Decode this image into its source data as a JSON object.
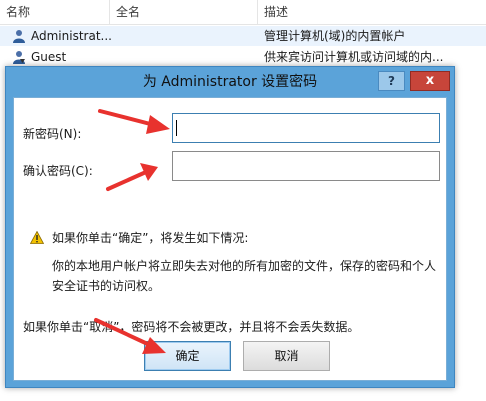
{
  "listview": {
    "columns": [
      "名称",
      "全名",
      "描述"
    ],
    "rows": [
      {
        "name": "Administrat...",
        "fullname": "",
        "description": "管理计算机(域)的内置帐户",
        "icon": "user-icon"
      },
      {
        "name": "Guest",
        "fullname": "",
        "description": "供来宾访问计算机或访问域的内...",
        "icon": "user-icon"
      }
    ]
  },
  "dialog": {
    "title": "为 Administrator 设置密码",
    "help_label": "?",
    "close_label": "x",
    "new_password_label": "新密码(N):",
    "new_password_value": "",
    "confirm_password_label": "确认密码(C):",
    "confirm_password_value": "",
    "warning_heading": "如果你单击“确定”，将发生如下情况:",
    "warning_line1": "你的本地用户帐户将立即失去对他的所有加密的文件，保存的密码和个人",
    "warning_line2": "安全证书的访问权。",
    "cancel_note": "如果你单击“取消”，密码将不会被更改，并且将不会丢失数据。",
    "ok_label": "确定",
    "cancel_label": "取消",
    "icons": [
      "warning-icon"
    ]
  },
  "colors": {
    "title_bar": "#5ba3d9",
    "close_button": "#c7453a",
    "annotation_arrow": "#e8322e"
  }
}
